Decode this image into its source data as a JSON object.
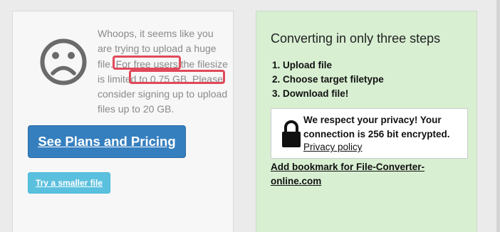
{
  "error_card": {
    "message_parts": [
      "Whoops, it seems like you are trying to upload a huge file. For ",
      "free users",
      " the filesize ",
      "is limited to 0.75 GB.",
      " Please consider signing up to upload files up to 20 GB."
    ],
    "primary_button": "See Plans and Pricing",
    "secondary_button": "Try a smaller file"
  },
  "info_card": {
    "heading": "Converting in only three steps",
    "steps": [
      "1. Upload file",
      "2. Choose target filetype",
      "3. Download file!"
    ],
    "privacy": {
      "text": "We respect your privacy! Your connection is 256 bit encrypted.",
      "link": "Privacy policy"
    },
    "bookmark_link": "Add bookmark for File-Converter-online.com"
  },
  "colors": {
    "highlight_border": "#e0495a",
    "primary_button_bg": "#357fbf",
    "secondary_button_bg": "#5bc0de",
    "info_card_bg": "#d8efd2"
  },
  "icons": {
    "face": "sad-face-icon",
    "lock": "lock-icon"
  }
}
